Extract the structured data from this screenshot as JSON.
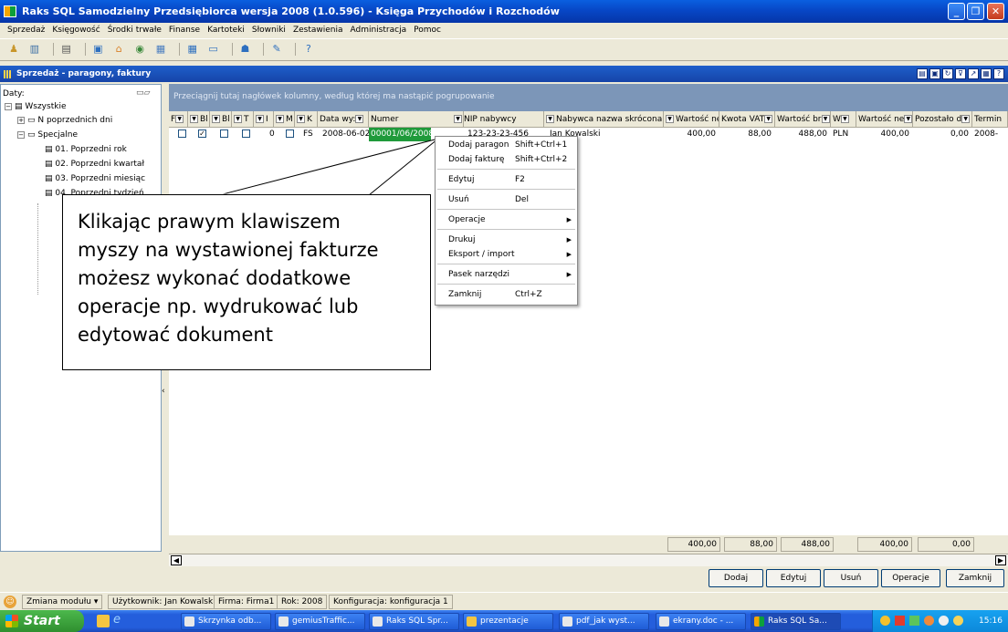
{
  "window": {
    "title": "Raks SQL Samodzielny Przedsiębiorca wersja 2008 (1.0.596) - Księga Przychodów i Rozchodów",
    "minimize": "_",
    "maximize": "❐",
    "close": "✕"
  },
  "menu": [
    "Sprzedaż",
    "Księgowość",
    "Środki trwałe",
    "Finanse",
    "Kartoteki",
    "Słowniki",
    "Zestawienia",
    "Administracja",
    "Pomoc"
  ],
  "module_title": "Sprzedaż - paragony, faktury",
  "tree": {
    "header": "Daty:",
    "items": [
      "Wszystkie",
      "N poprzednich dni",
      "Specjalne",
      "01. Poprzedni rok",
      "02. Poprzedni kwartał",
      "03. Poprzedni miesiąc",
      "04. Poprzedni tydzień"
    ]
  },
  "group_hint": "Przeciągnij tutaj nagłówek kolumny, według której ma nastąpić pogrupowanie",
  "columns": [
    "F",
    "Bl",
    "Bl",
    "T",
    "I",
    "M",
    "K",
    "Data wy:",
    "Numer",
    "NIP nabywcy",
    "Nabywca nazwa skrócona",
    "Wartość ne",
    "Kwota VAT",
    "Wartość br",
    "W",
    "Wartość ne",
    "Pozostało d",
    "Termin"
  ],
  "row": {
    "zero": "0",
    "type": "FS",
    "date": "2008-06-02",
    "number": "00001/06/2008",
    "nip": "123-23-23-456",
    "buyer": "Jan Kowalski",
    "net": "400,00",
    "vat": "88,00",
    "gross": "488,00",
    "currency": "PLN",
    "net2": "400,00",
    "remaining": "0,00",
    "term": "2008-"
  },
  "totals": {
    "net": "400,00",
    "vat": "88,00",
    "gross": "488,00",
    "net2": "400,00",
    "remaining": "0,00"
  },
  "context_menu": {
    "add_receipt": "Dodaj paragon",
    "add_receipt_sc": "Shift+Ctrl+1",
    "add_invoice": "Dodaj fakturę",
    "add_invoice_sc": "Shift+Ctrl+2",
    "edit": "Edytuj",
    "edit_sc": "F2",
    "delete": "Usuń",
    "delete_sc": "Del",
    "operations": "Operacje",
    "print": "Drukuj",
    "export": "Eksport / import",
    "toolbar": "Pasek narzędzi",
    "close": "Zamknij",
    "close_sc": "Ctrl+Z"
  },
  "callout": [
    "Klikając prawym klawiszem",
    "myszy na wystawionej fakturze",
    "możesz wykonać dodatkowe",
    "operacje np. wydrukować lub",
    "edytować dokument"
  ],
  "buttons": {
    "add": "Dodaj",
    "edit": "Edytuj",
    "delete": "Usuń",
    "operations": "Operacje",
    "close": "Zamknij"
  },
  "status": {
    "module_change": "Zmiana modułu",
    "user": "Użytkownik: Jan Kowalski",
    "company": "Firma: Firma1",
    "year": "Rok: 2008",
    "config": "Konfiguracja: konfiguracja 1"
  },
  "taskbar": {
    "start": "Start",
    "tasks": [
      "Skrzynka odb...",
      "gemiusTraffic...",
      "Raks SQL Spr...",
      "prezentacje",
      "pdf_jak wyst...",
      "ekrany.doc - ...",
      "Raks SQL Sa..."
    ],
    "clock": "15:16"
  }
}
